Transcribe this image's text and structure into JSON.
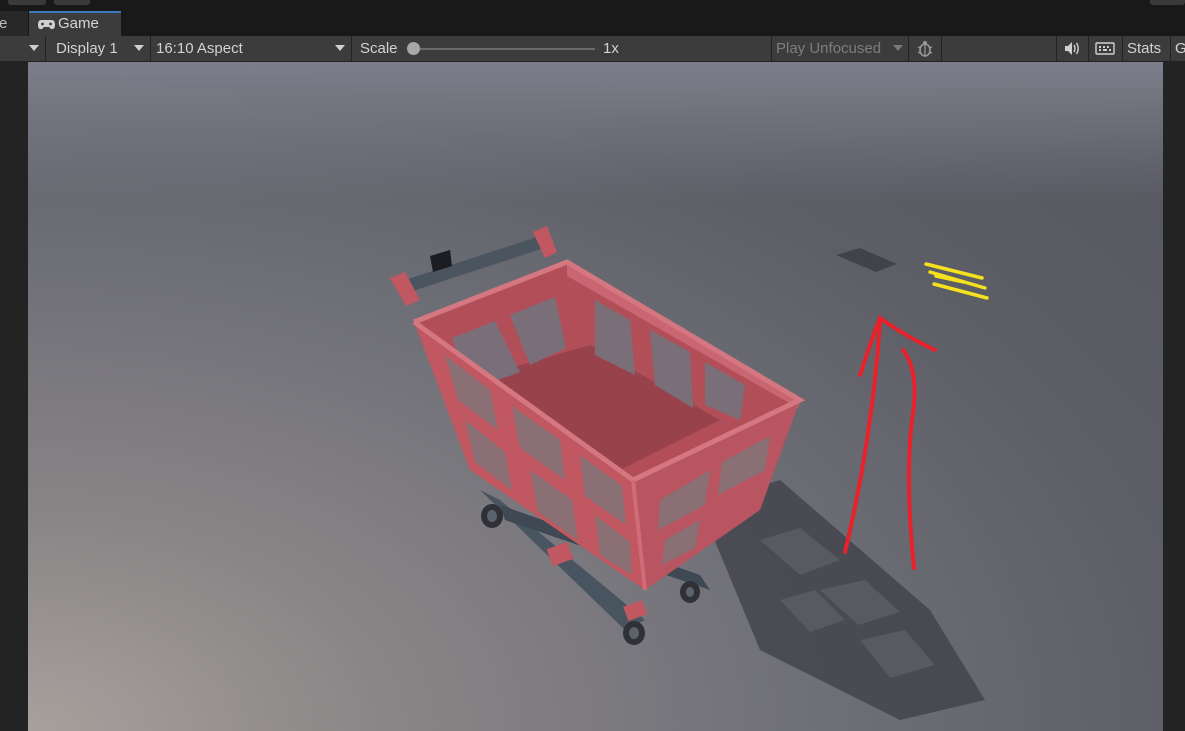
{
  "tabs": {
    "scene_partial": "e",
    "game_label": "Game"
  },
  "toolbar": {
    "display_label": "Display 1",
    "aspect_label": "16:10 Aspect",
    "scale_label": "Scale",
    "scale_value": "1x",
    "scale_fraction": 0.0,
    "play_mode_label": "Play Unfocused",
    "stats_label": "Stats",
    "gizmos_partial": "G"
  },
  "icons": {
    "game_tab": "gamepad-icon",
    "bug": "bug-icon",
    "audio": "speaker-icon",
    "shortcuts": "keyboard-icon"
  },
  "colors": {
    "toolbar_bg": "#3c3c3c",
    "active_tab_accent": "#3a79bb",
    "cart_red": "#c05761",
    "cart_frame": "#4a5560",
    "red_annotation": "#e8212a",
    "yellow_annotation": "#f5e11d"
  }
}
